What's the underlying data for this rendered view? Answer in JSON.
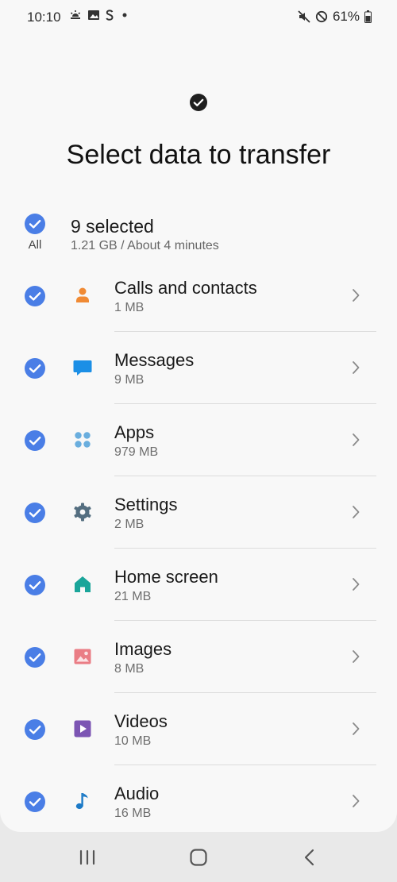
{
  "status_bar": {
    "time": "10:10",
    "battery": "61%",
    "icons_left": [
      "weather-icon",
      "gallery-icon",
      "s-app-icon",
      "dot-icon"
    ],
    "icons_right": [
      "mute-icon",
      "do-not-disturb-icon",
      "battery-icon"
    ]
  },
  "header": {
    "title": "Select data to transfer"
  },
  "select_all": {
    "label": "All",
    "count": "9 selected",
    "summary": "1.21 GB / About 4 minutes"
  },
  "items": [
    {
      "title": "Calls and contacts",
      "size": "1 MB",
      "icon": "contacts-icon",
      "color": "#f08a34"
    },
    {
      "title": "Messages",
      "size": "9 MB",
      "icon": "messages-icon",
      "color": "#1b8fe6"
    },
    {
      "title": "Apps",
      "size": "979 MB",
      "icon": "apps-icon",
      "color": "#6aaede"
    },
    {
      "title": "Settings",
      "size": "2 MB",
      "icon": "settings-icon",
      "color": "#546e80"
    },
    {
      "title": "Home screen",
      "size": "21 MB",
      "icon": "home-screen-icon",
      "color": "#1aa59a"
    },
    {
      "title": "Images",
      "size": "8 MB",
      "icon": "images-icon",
      "color": "#ea7d85"
    },
    {
      "title": "Videos",
      "size": "10 MB",
      "icon": "videos-icon",
      "color": "#7c55b3"
    },
    {
      "title": "Audio",
      "size": "16 MB",
      "icon": "audio-icon",
      "color": "#1c7ac7"
    }
  ],
  "colors": {
    "check": "#4a7ee6",
    "background": "#f8f8f8"
  }
}
